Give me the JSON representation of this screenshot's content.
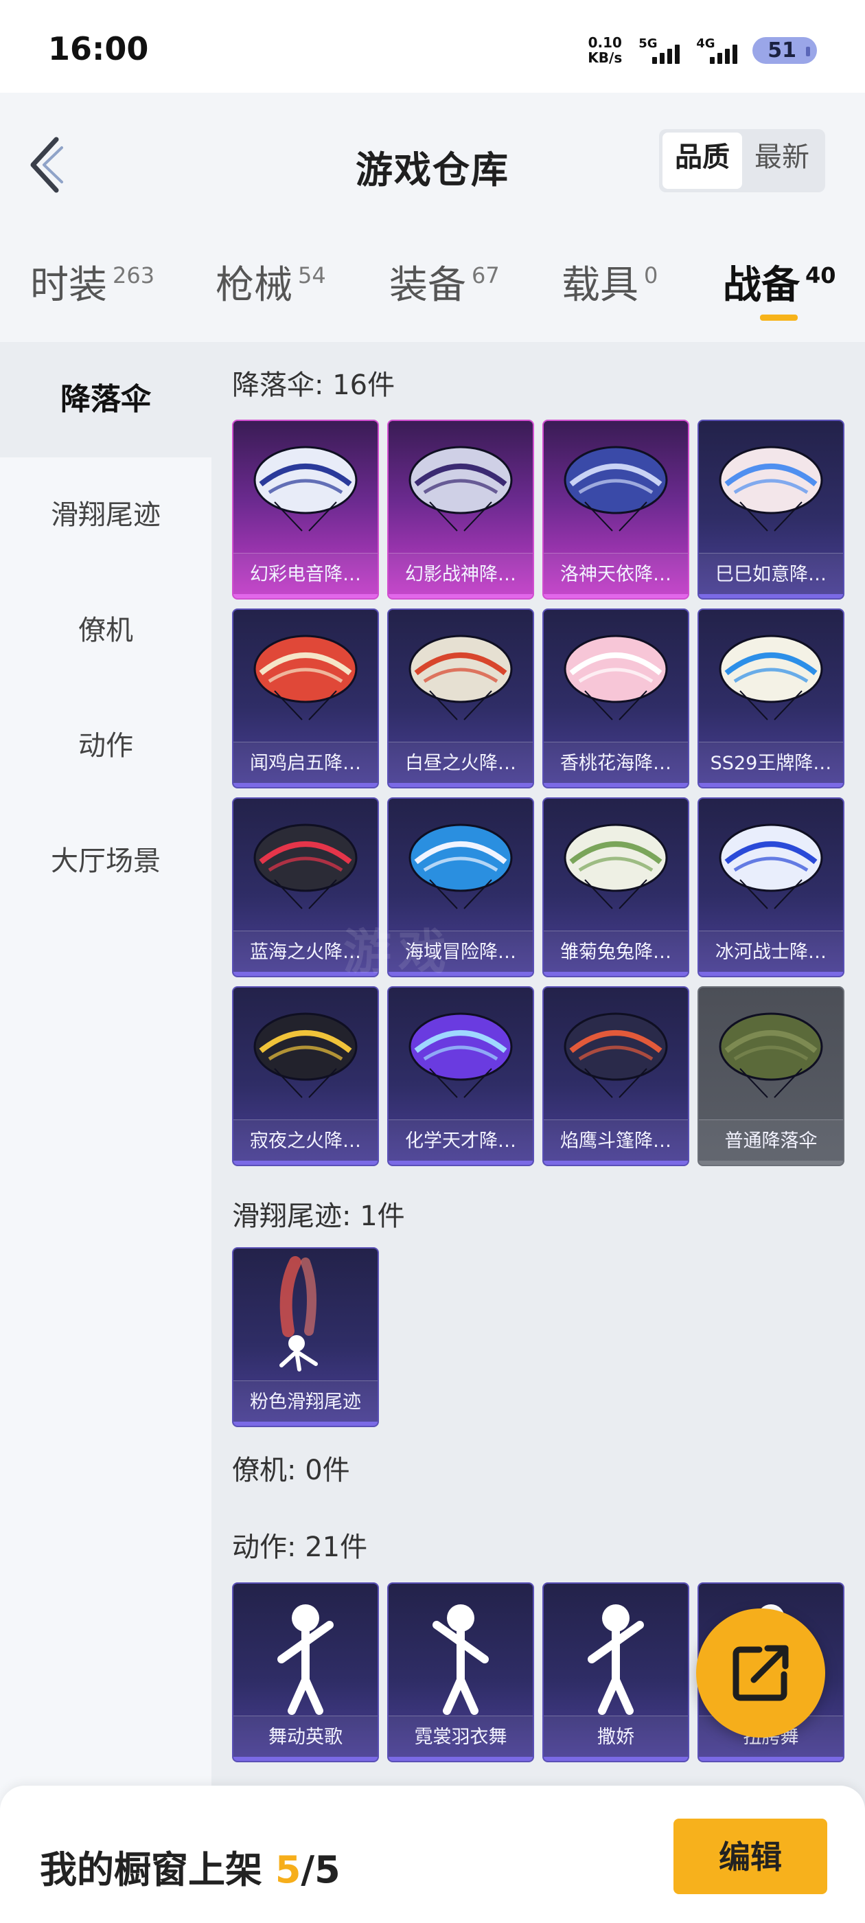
{
  "status_bar": {
    "time": "16:00",
    "net_speed_value": "0.10",
    "net_speed_unit": "KB/s",
    "signal1_label": "5G",
    "signal2_label": "4G",
    "battery": "51"
  },
  "header": {
    "title": "游戏仓库",
    "sort_options": [
      "品质",
      "最新"
    ],
    "active_sort": "品质"
  },
  "tabs": [
    {
      "label": "时装",
      "count": "263"
    },
    {
      "label": "枪械",
      "count": "54"
    },
    {
      "label": "装备",
      "count": "67"
    },
    {
      "label": "载具",
      "count": "0"
    },
    {
      "label": "战备",
      "count": "40"
    }
  ],
  "active_tab": "战备",
  "sidebar": {
    "items": [
      "降落伞",
      "滑翔尾迹",
      "僚机",
      "动作",
      "大厅场景"
    ],
    "active": "降落伞"
  },
  "sections": {
    "parachute": {
      "title": "降落伞: 16件",
      "items": [
        {
          "label": "幻彩电音降…",
          "rarity": "pink"
        },
        {
          "label": "幻影战神降…",
          "rarity": "pink"
        },
        {
          "label": "洛神天依降…",
          "rarity": "pink"
        },
        {
          "label": "巳巳如意降…",
          "rarity": "purple"
        },
        {
          "label": "闻鸡启五降…",
          "rarity": "purple"
        },
        {
          "label": "白昼之火降…",
          "rarity": "purple"
        },
        {
          "label": "香桃花海降…",
          "rarity": "purple"
        },
        {
          "label": "SS29王牌降…",
          "rarity": "purple"
        },
        {
          "label": "蓝海之火降…",
          "rarity": "purple"
        },
        {
          "label": "海域冒险降…",
          "rarity": "purple"
        },
        {
          "label": "雏菊兔兔降…",
          "rarity": "purple"
        },
        {
          "label": "冰河战士降…",
          "rarity": "purple"
        },
        {
          "label": "寂夜之火降…",
          "rarity": "purple"
        },
        {
          "label": "化学天才降…",
          "rarity": "purple"
        },
        {
          "label": "焰鹰斗篷降…",
          "rarity": "purple"
        },
        {
          "label": "普通降落伞",
          "rarity": "gray"
        }
      ]
    },
    "trail": {
      "title": "滑翔尾迹: 1件",
      "items": [
        {
          "label": "粉色滑翔尾迹",
          "rarity": "purple"
        }
      ]
    },
    "wingman": {
      "title": "僚机: 0件"
    },
    "emote": {
      "title": "动作: 21件",
      "items": [
        {
          "label": "舞动英歌",
          "rarity": "purple"
        },
        {
          "label": "霓裳羽衣舞",
          "rarity": "purple"
        },
        {
          "label": "撒娇",
          "rarity": "purple"
        },
        {
          "label": "扭胯舞",
          "rarity": "purple"
        }
      ]
    }
  },
  "watermark": "游戏",
  "fab": {
    "icon": "share-icon"
  },
  "bottom_bar": {
    "shelf_label": "我的橱窗上架",
    "shelf_count": "5",
    "shelf_total": "/5",
    "edit_label": "编辑"
  },
  "colors": {
    "accent": "#f7b11c",
    "card_purple": "#2f2d66",
    "card_pink": "#c43dc9",
    "card_gray": "#5a5e67"
  }
}
